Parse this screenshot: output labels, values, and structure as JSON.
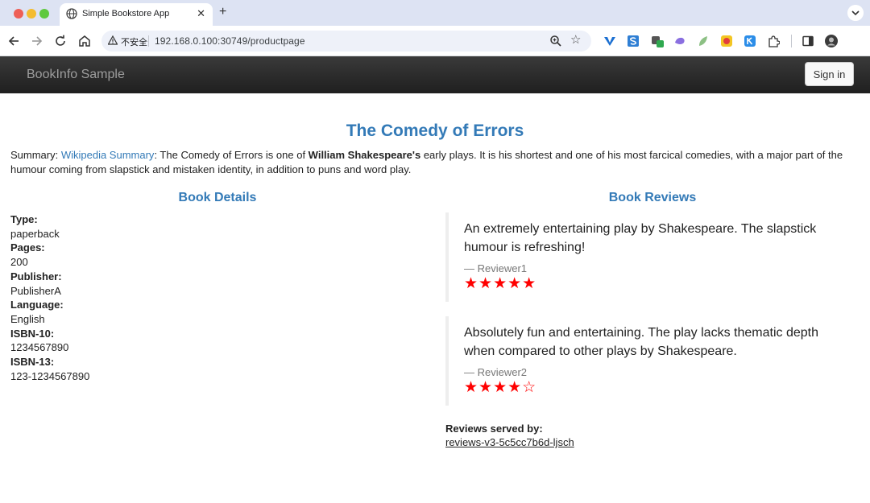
{
  "browser": {
    "tab_title": "Simple Bookstore App",
    "tab_close": "✕",
    "new_tab": "+",
    "insecure_label": "不安全",
    "url": "192.168.0.100:30749/productpage",
    "bookmark_star": "☆"
  },
  "app": {
    "brand": "BookInfo Sample",
    "sign_in": "Sign in"
  },
  "book": {
    "title": "The Comedy of Errors",
    "summary_label": "Summary: ",
    "summary_link": "Wikipedia Summary",
    "summary_text_1": ": The Comedy of Errors is one of ",
    "summary_bold": "William Shakespeare's",
    "summary_text_2": " early plays. It is his shortest and one of his most farcical comedies, with a major part of the humour coming from slapstick and mistaken identity, in addition to puns and word play."
  },
  "details": {
    "heading": "Book Details",
    "fields": [
      {
        "label": "Type:",
        "value": "paperback"
      },
      {
        "label": "Pages:",
        "value": "200"
      },
      {
        "label": "Publisher:",
        "value": "PublisherA"
      },
      {
        "label": "Language:",
        "value": "English"
      },
      {
        "label": "ISBN-10:",
        "value": "1234567890"
      },
      {
        "label": "ISBN-13:",
        "value": "123-1234567890"
      }
    ]
  },
  "reviews": {
    "heading": "Book Reviews",
    "items": [
      {
        "text": "An extremely entertaining play by Shakespeare. The slapstick humour is refreshing!",
        "author": "— Reviewer1",
        "stars": "★★★★★",
        "rating": 5
      },
      {
        "text": "Absolutely fun and entertaining. The play lacks thematic depth when compared to other plays by Shakespeare.",
        "author": "— Reviewer2",
        "stars": "★★★★☆",
        "rating": 4
      }
    ],
    "served_by_label": "Reviews served by:",
    "served_by_value": "reviews-v3-5c5cc7b6d-ljsch"
  },
  "colors": {
    "link": "#337ab7",
    "star": "#ff0000",
    "header_bg": "#222222"
  },
  "icons": [
    "globe-icon",
    "back-arrow-icon",
    "forward-arrow-icon",
    "reload-icon",
    "home-icon",
    "warning-icon",
    "zoom-icon",
    "star-icon",
    "extensions-icon",
    "side-panel-icon",
    "profile-avatar"
  ]
}
